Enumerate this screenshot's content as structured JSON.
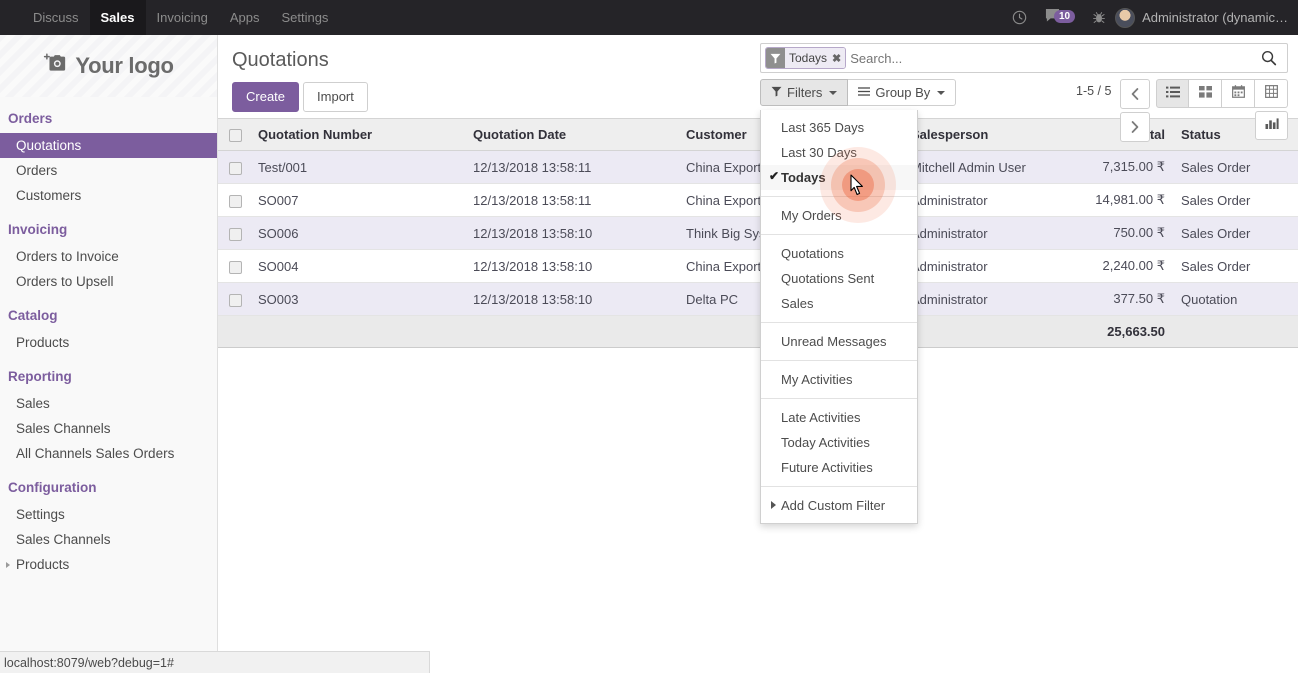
{
  "navbar": {
    "menu": [
      {
        "label": "Discuss",
        "active": false
      },
      {
        "label": "Sales",
        "active": true
      },
      {
        "label": "Invoicing",
        "active": false
      },
      {
        "label": "Apps",
        "active": false
      },
      {
        "label": "Settings",
        "active": false
      }
    ],
    "clock_icon": "clock-icon",
    "messages_icon": "message-bubble-icon",
    "messages_count": "10",
    "debug_icon": "bug-icon",
    "avatar": "user-avatar",
    "user_name": "Administrator (dynamic…"
  },
  "sidebar": {
    "logo_text": "Your logo",
    "logo_icon": "camera-icon",
    "sections": [
      {
        "title": "Orders",
        "items": [
          {
            "label": "Quotations",
            "active": true,
            "caret": false
          },
          {
            "label": "Orders",
            "active": false,
            "caret": false
          },
          {
            "label": "Customers",
            "active": false,
            "caret": false
          }
        ]
      },
      {
        "title": "Invoicing",
        "items": [
          {
            "label": "Orders to Invoice",
            "active": false,
            "caret": false
          },
          {
            "label": "Orders to Upsell",
            "active": false,
            "caret": false
          }
        ]
      },
      {
        "title": "Catalog",
        "items": [
          {
            "label": "Products",
            "active": false,
            "caret": false
          }
        ]
      },
      {
        "title": "Reporting",
        "items": [
          {
            "label": "Sales",
            "active": false,
            "caret": false
          },
          {
            "label": "Sales Channels",
            "active": false,
            "caret": false
          },
          {
            "label": "All Channels Sales Orders",
            "active": false,
            "caret": false
          }
        ]
      },
      {
        "title": "Configuration",
        "items": [
          {
            "label": "Settings",
            "active": false,
            "caret": false
          },
          {
            "label": "Sales Channels",
            "active": false,
            "caret": false
          },
          {
            "label": "Products",
            "active": false,
            "caret": true
          }
        ]
      }
    ]
  },
  "control_panel": {
    "title": "Quotations",
    "create_label": "Create",
    "import_label": "Import",
    "filters_label": "Filters",
    "filters_icon": "funnel-icon",
    "groupby_label": "Group By",
    "groupby_icon": "hamburger-icon",
    "pager": "1-5 / 5",
    "pager_prev_icon": "chevron-left-icon",
    "pager_next_icon": "chevron-right-icon",
    "views": [
      {
        "name": "list-view",
        "icon": "list-icon",
        "active": true
      },
      {
        "name": "kanban-view",
        "icon": "kanban-icon",
        "active": false
      },
      {
        "name": "calendar-view",
        "icon": "calendar-icon",
        "active": false
      },
      {
        "name": "pivot-view",
        "icon": "pivot-table-icon",
        "active": false
      },
      {
        "name": "graph-view",
        "icon": "bar-chart-icon",
        "active": false
      }
    ]
  },
  "search": {
    "facet_label": "Todays",
    "facet_icon": "funnel-icon",
    "facet_remove_icon": "close-x-icon",
    "placeholder": "Search...",
    "value": "",
    "search_icon": "magnifier-icon"
  },
  "filters_dropdown": {
    "groups": [
      {
        "items": [
          {
            "label": "Last 365 Days",
            "checked": false
          },
          {
            "label": "Last 30 Days",
            "checked": false
          },
          {
            "label": "Todays",
            "checked": true
          }
        ]
      },
      {
        "items": [
          {
            "label": "My Orders",
            "checked": false
          }
        ]
      },
      {
        "items": [
          {
            "label": "Quotations",
            "checked": false
          },
          {
            "label": "Quotations Sent",
            "checked": false
          },
          {
            "label": "Sales",
            "checked": false
          }
        ]
      },
      {
        "items": [
          {
            "label": "Unread Messages",
            "checked": false
          }
        ]
      },
      {
        "items": [
          {
            "label": "My Activities",
            "checked": false
          }
        ]
      },
      {
        "items": [
          {
            "label": "Late Activities",
            "checked": false
          },
          {
            "label": "Today Activities",
            "checked": false
          },
          {
            "label": "Future Activities",
            "checked": false
          }
        ]
      }
    ],
    "add_custom_filter": "Add Custom Filter"
  },
  "table": {
    "columns": [
      "Quotation Number",
      "Quotation Date",
      "Customer",
      "Salesperson",
      "Total",
      "Status"
    ],
    "rows": [
      {
        "number": "Test/001",
        "date": "12/13/2018 13:58:11",
        "customer": "China Export",
        "salesperson": "Mitchell Admin User",
        "total": "7,315.00 ₹",
        "status": "Sales Order"
      },
      {
        "number": "SO007",
        "date": "12/13/2018 13:58:11",
        "customer": "China Export",
        "salesperson": "Administrator",
        "total": "14,981.00 ₹",
        "status": "Sales Order"
      },
      {
        "number": "SO006",
        "date": "12/13/2018 13:58:10",
        "customer": "Think Big Systems",
        "salesperson": "Administrator",
        "total": "750.00 ₹",
        "status": "Sales Order"
      },
      {
        "number": "SO004",
        "date": "12/13/2018 13:58:10",
        "customer": "China Export",
        "salesperson": "Administrator",
        "total": "2,240.00 ₹",
        "status": "Sales Order"
      },
      {
        "number": "SO003",
        "date": "12/13/2018 13:58:10",
        "customer": "Delta PC",
        "salesperson": "Administrator",
        "total": "377.50 ₹",
        "status": "Quotation"
      }
    ],
    "footer_total": "25,663.50"
  },
  "statusbar": {
    "url": "localhost:8079/web?debug=1#"
  },
  "colors": {
    "accent": "#7c5d9e",
    "navbar_bg": "#252428",
    "row_odd": "#eceaf4",
    "ripple": "#ee6e46"
  }
}
